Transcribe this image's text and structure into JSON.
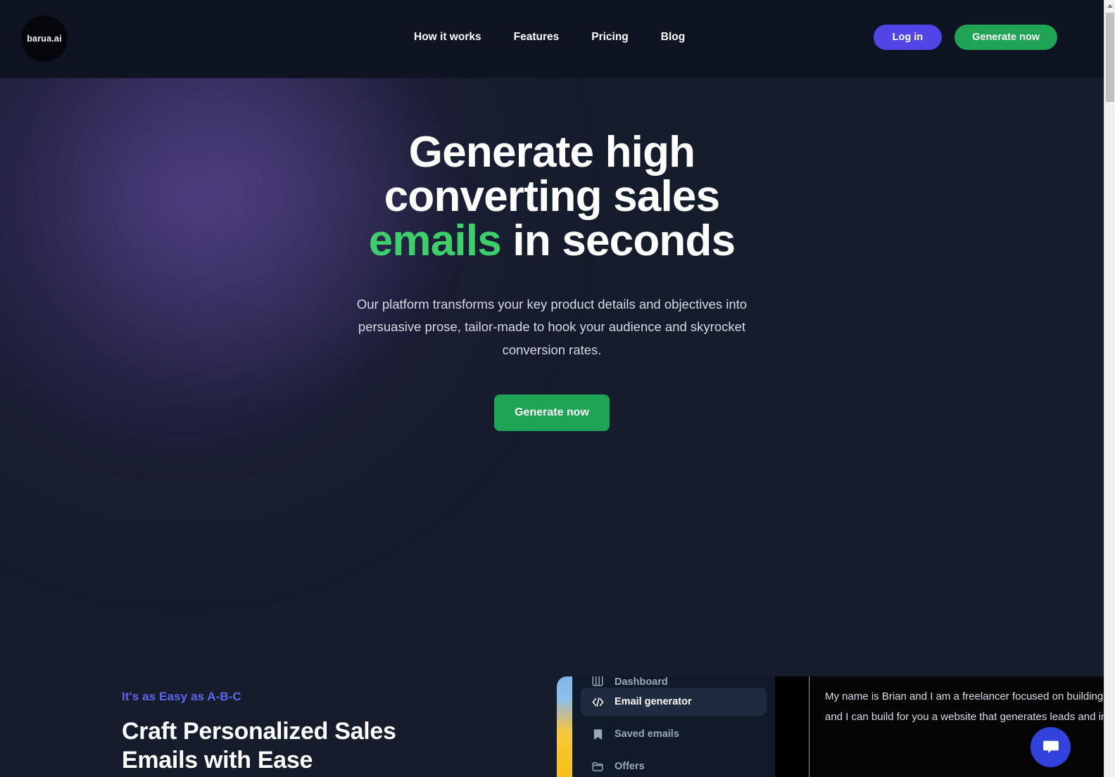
{
  "brand": {
    "logo_text": "barua.ai",
    "accent_green": "#1fa354",
    "accent_purple": "#5145e8",
    "highlight_green": "#3ecf6a",
    "eyebrow_purple": "#6067ee",
    "background": "#151c2c",
    "header_background": "#0e1422"
  },
  "header": {
    "nav": [
      {
        "label": "How it works"
      },
      {
        "label": "Features"
      },
      {
        "label": "Pricing"
      },
      {
        "label": "Blog"
      }
    ],
    "login_label": "Log in",
    "generate_label": "Generate now"
  },
  "hero": {
    "title_line1": "Generate high",
    "title_line2": "converting sales",
    "title_highlight": "emails",
    "title_line3_rest": " in seconds",
    "subtitle": "Our platform transforms your key product details and objectives into persuasive prose, tailor-made to hook your audience and skyrocket conversion rates.",
    "cta_label": "Generate now"
  },
  "feature": {
    "eyebrow": "It's as Easy as A-B-C",
    "heading_line1": "Craft Personalized Sales",
    "heading_line2": "Emails with Ease"
  },
  "mockup": {
    "sidebar": [
      {
        "label": "Dashboard",
        "icon": "dashboard-icon",
        "active": false
      },
      {
        "label": "Email generator",
        "icon": "code-icon",
        "active": true
      },
      {
        "label": "Saved emails",
        "icon": "bookmark-icon",
        "active": false
      },
      {
        "label": "Offers",
        "icon": "folder-icon",
        "active": false
      }
    ],
    "editor": {
      "line1": "My name is Brian and I am a freelancer focused on building websites",
      "line2": "and I can build for you a website that generates leads and increases"
    }
  },
  "chat": {
    "icon": "chat-bubble-icon"
  },
  "scrollbar": {
    "up_arrow": "scroll-up-arrow"
  }
}
